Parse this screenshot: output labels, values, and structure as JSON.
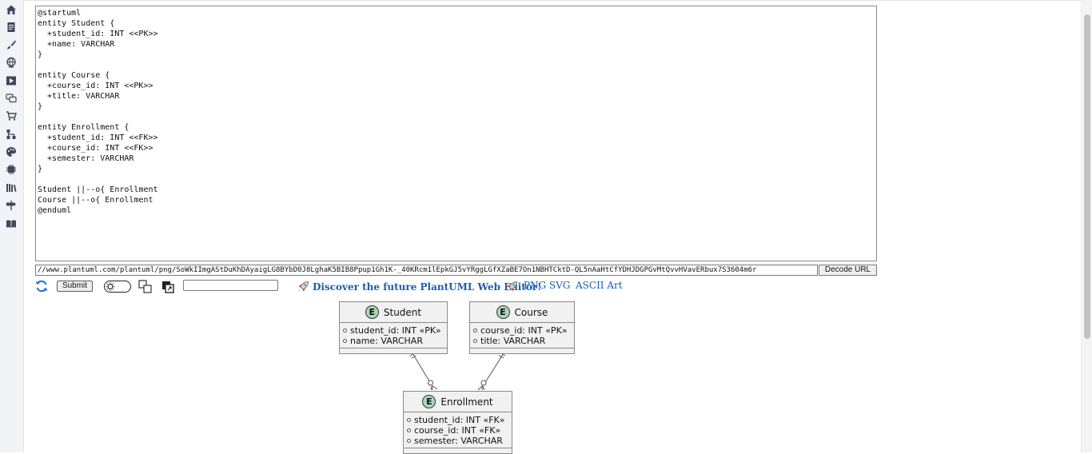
{
  "editor": {
    "source": "@startuml\nentity Student {\n  +student_id: INT <<PK>>\n  +name: VARCHAR\n}\n\nentity Course {\n  +course_id: INT <<PK>>\n  +title: VARCHAR\n}\n\nentity Enrollment {\n  +student_id: INT <<FK>>\n  +course_id: INT <<FK>>\n  +semester: VARCHAR\n}\n\nStudent ||--o{ Enrollment\nCourse ||--o{ Enrollment\n@enduml"
  },
  "url_bar": {
    "value": "//www.plantuml.com/plantuml/png/SoWkIImgAStDuKhDAyaigLG8BYbD0J8LghaK5BIB8Ppup1Gh1K-_40KRcm1lEpkGJ5vYRggLGfXZaBE7On1NBHTCktD-QL5nAaHtCfYDHJDGPGvMtQvvHVavERbux7S3604m6r",
    "decode_label": "Decode URL"
  },
  "toolbar": {
    "submit_label": "Submit",
    "select_value": "",
    "discover_text": "Discover the future PlantUML Web Editor!",
    "links": [
      "PNG",
      "SVG",
      "ASCII Art"
    ]
  },
  "sidebar": {
    "icons": [
      "home-icon",
      "document-icon",
      "brush-icon",
      "globe-icon",
      "play-icon",
      "chat-icon",
      "cart-icon",
      "sitemap-icon",
      "palette-icon",
      "chip-icon",
      "library-icon",
      "signpost-icon",
      "book-icon"
    ]
  },
  "diagram": {
    "entities": [
      {
        "name": "Student",
        "badge": "E",
        "attrs": [
          "student_id: INT «PK»",
          "name: VARCHAR"
        ]
      },
      {
        "name": "Course",
        "badge": "E",
        "attrs": [
          "course_id: INT «PK»",
          "title: VARCHAR"
        ]
      },
      {
        "name": "Enrollment",
        "badge": "E",
        "attrs": [
          "student_id: INT «FK»",
          "course_id: INT «FK»",
          "semester: VARCHAR"
        ]
      }
    ]
  },
  "colors": {
    "link": "#1a5db0",
    "entity_fill": "#f1f1f1",
    "entity_badge": "#a9d8b8",
    "rail": "#f1f3f7"
  }
}
